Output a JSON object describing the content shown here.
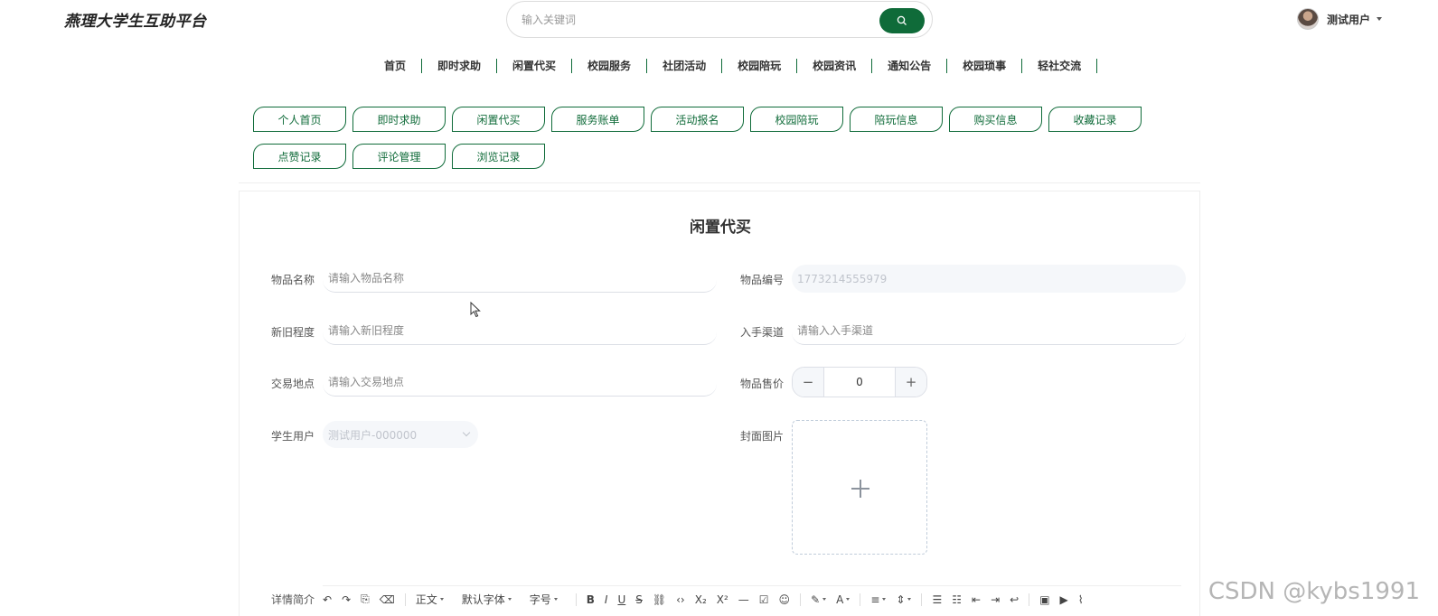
{
  "header": {
    "logo": "燕理大学生互助平台",
    "search_placeholder": "输入关键词",
    "user_name": "测试用户"
  },
  "nav": [
    "首页",
    "即时求助",
    "闲置代买",
    "校园服务",
    "社团活动",
    "校园陪玩",
    "校园资讯",
    "通知公告",
    "校园琐事",
    "轻社交流"
  ],
  "sub_nav": [
    "个人首页",
    "即时求助",
    "闲置代买",
    "服务账单",
    "活动报名",
    "校园陪玩",
    "陪玩信息",
    "购买信息",
    "收藏记录",
    "点赞记录",
    "评论管理",
    "浏览记录"
  ],
  "form": {
    "title": "闲置代买",
    "item_name_label": "物品名称",
    "item_name_placeholder": "请输入物品名称",
    "item_no_label": "物品编号",
    "item_no_value": "1773214555979",
    "condition_label": "新旧程度",
    "condition_placeholder": "请输入新旧程度",
    "channel_label": "入手渠道",
    "channel_placeholder": "请输入入手渠道",
    "location_label": "交易地点",
    "location_placeholder": "请输入交易地点",
    "price_label": "物品售价",
    "price_value": "0",
    "student_label": "学生用户",
    "student_value": "测试用户-000000",
    "cover_label": "封面图片",
    "detail_label": "详情简介"
  },
  "toolbar": {
    "paragraph": "正文",
    "font": "默认字体",
    "size": "字号"
  },
  "watermark": "CSDN @kybs1991",
  "colors": {
    "accent": "#0f6b39"
  }
}
